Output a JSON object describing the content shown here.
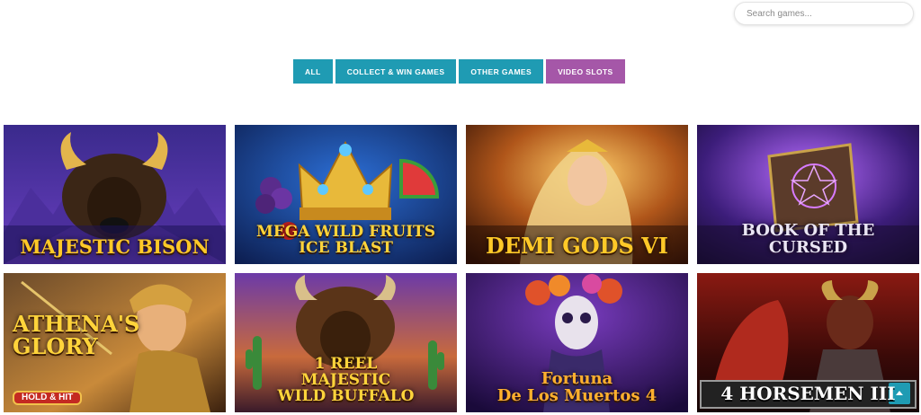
{
  "search": {
    "placeholder": "Search games..."
  },
  "filters": [
    {
      "label": "ALL",
      "active": false
    },
    {
      "label": "COLLECT & WIN GAMES",
      "active": false
    },
    {
      "label": "OTHER GAMES",
      "active": false
    },
    {
      "label": "VIDEO SLOTS",
      "active": true
    }
  ],
  "colors": {
    "filter": "#1f9bb3",
    "filter_active": "#a557a8",
    "scroll_top": "#1f9bb3"
  },
  "games": [
    {
      "title": "MAJESTIC BISON"
    },
    {
      "title": "MEGA WILD FRUITS\nICE BLAST"
    },
    {
      "title": "DEMI GODS VI"
    },
    {
      "title": "BOOK OF THE CURSED"
    },
    {
      "title": "ATHENA'S\nGLORY",
      "badge": "HOLD & HIT"
    },
    {
      "title": "1 REEL\nMAJESTIC\nWILD BUFFALO"
    },
    {
      "title": "Fortuna\nDe Los Muertos 4"
    },
    {
      "title": "4 HORSEMEN III"
    }
  ],
  "scroll_top": {
    "icon": "chevron-up-icon"
  }
}
